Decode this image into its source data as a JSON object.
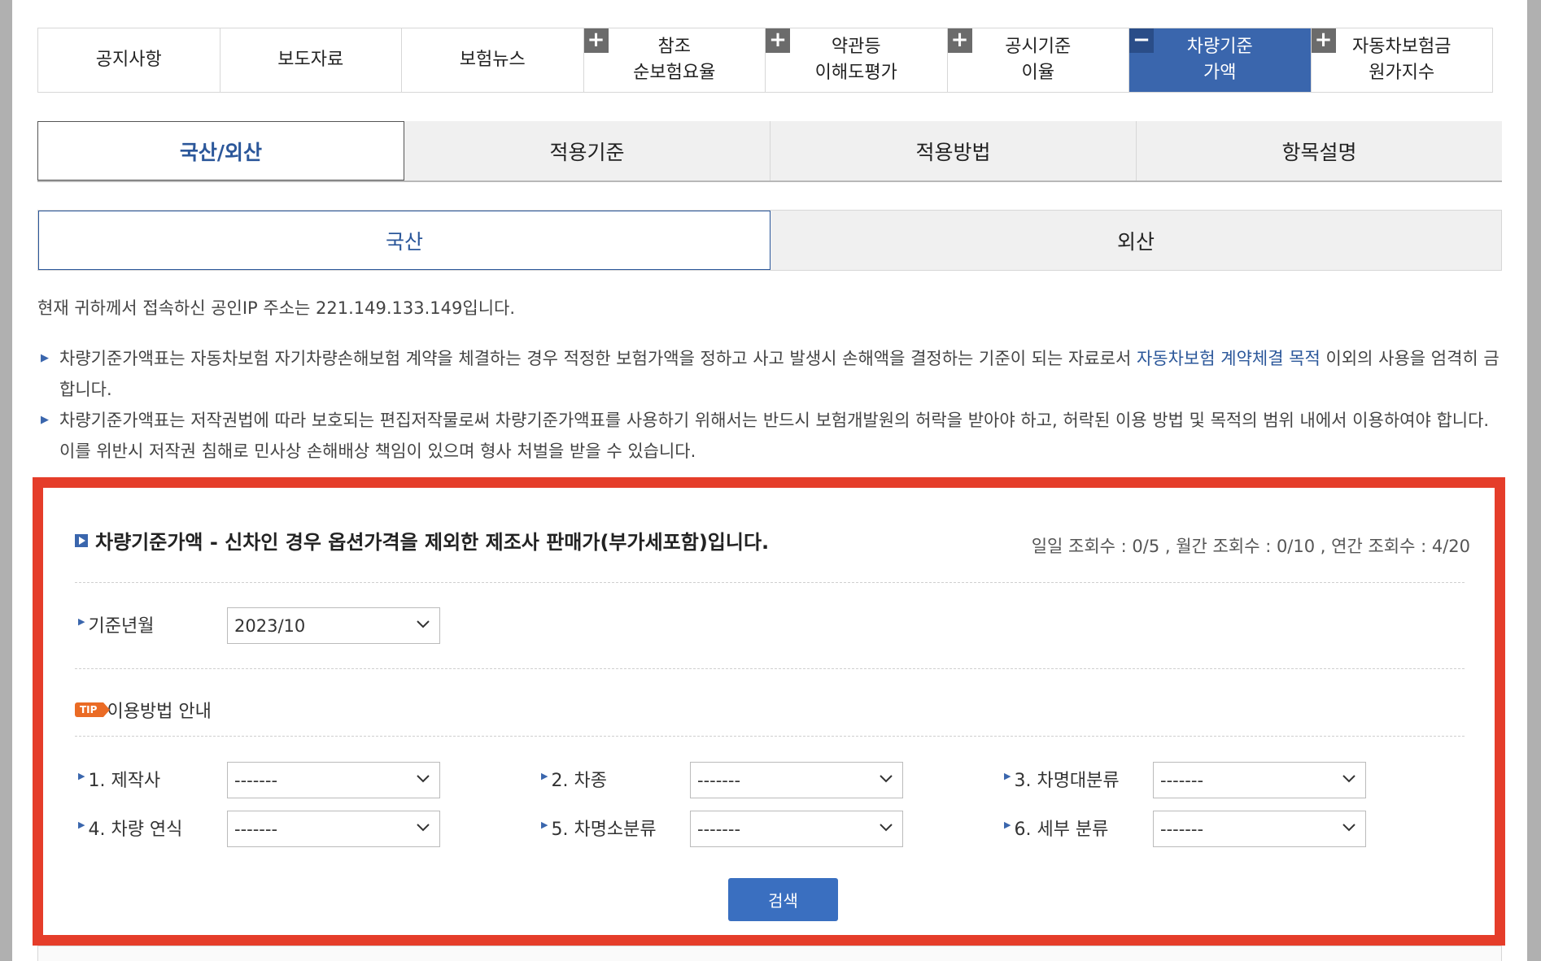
{
  "top_tabs": [
    {
      "label": "공지사항",
      "toggle": "",
      "active": false
    },
    {
      "label": "보도자료",
      "toggle": "",
      "active": false
    },
    {
      "label": "보험뉴스",
      "toggle": "",
      "active": false
    },
    {
      "label": "참조\n순보험요율",
      "toggle": "+",
      "active": false
    },
    {
      "label": "약관등\n이해도평가",
      "toggle": "+",
      "active": false
    },
    {
      "label": "공시기준\n이율",
      "toggle": "+",
      "active": false
    },
    {
      "label": "차량기준\n가액",
      "toggle": "−",
      "active": true
    },
    {
      "label": "자동차보험금\n원가지수",
      "toggle": "+",
      "active": false
    }
  ],
  "tabs2": [
    {
      "label": "국산/외산",
      "active": true
    },
    {
      "label": "적용기준",
      "active": false
    },
    {
      "label": "적용방법",
      "active": false
    },
    {
      "label": "항목설명",
      "active": false
    }
  ],
  "tabs3": [
    {
      "label": "국산",
      "active": true
    },
    {
      "label": "외산",
      "active": false
    }
  ],
  "ip_notice": "현재 귀하께서 접속하신 공인IP 주소는 221.149.133.149입니다.",
  "notices": {
    "n1_before": "차량기준가액표는 자동차보험 자기차량손해보험 계약을 체결하는 경우 적정한 보험가액을 정하고 사고 발생시 손해액을 결정하는 기준이 되는 자료로서 ",
    "n1_link": "자동차보험 계약체결 목적",
    "n1_after": " 이외의 사용을 엄격히 금합니다.",
    "n2": "차량기준가액표는 저작권법에 따라 보호되는 편집저작물로써 차량기준가액표를 사용하기 위해서는 반드시 보험개발원의 허락을 받아야 하고, 허락된 이용 방법 및 목적의 범위 내에서 이용하여야 합니다. 이를 위반시 저작권 침해로 민사상 손해배상 책임이 있으며 형사 처벌을 받을 수 있습니다."
  },
  "panel": {
    "title": "차량기준가액 - 신차인 경우 옵션가격을 제외한 제조사 판매가(부가세포함)입니다.",
    "view_counts": "일일 조회수 : 0/5 , 월간 조회수 : 0/10 , 연간 조회수 : 4/20",
    "base_month_label": "기준년월",
    "base_month_value": "2023/10",
    "tip_badge": "TIP",
    "tip_label": "이용방법 안내",
    "fields": [
      {
        "label": "1. 제작사",
        "value": "-------"
      },
      {
        "label": "2. 차종",
        "value": "-------"
      },
      {
        "label": "3. 차명대분류",
        "value": "-------"
      },
      {
        "label": "4. 차량 연식",
        "value": "-------"
      },
      {
        "label": "5. 차명소분류",
        "value": "-------"
      },
      {
        "label": "6. 세부 분류",
        "value": "-------"
      }
    ],
    "search_label": "검색"
  },
  "colors": {
    "active_tab": "#3a66ad",
    "frame": "#e53d2a",
    "link": "#2b579a",
    "button": "#3a6fc0"
  }
}
